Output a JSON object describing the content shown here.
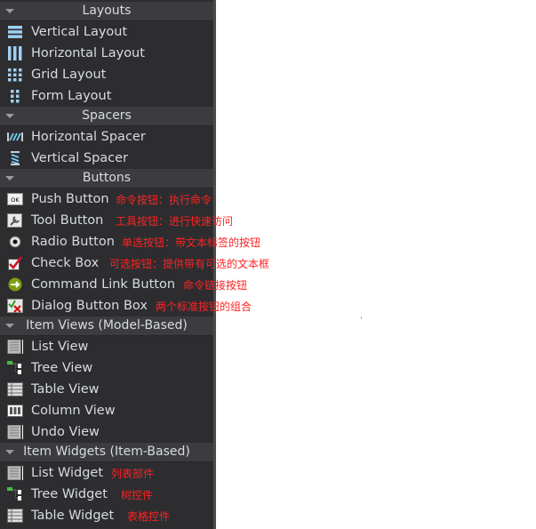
{
  "sections": [
    {
      "title": "Layouts",
      "items": [
        {
          "label": "Vertical Layout",
          "icon": "vertical-layout-icon"
        },
        {
          "label": "Horizontal Layout",
          "icon": "horizontal-layout-icon"
        },
        {
          "label": "Grid Layout",
          "icon": "grid-layout-icon"
        },
        {
          "label": "Form Layout",
          "icon": "form-layout-icon"
        }
      ]
    },
    {
      "title": "Spacers",
      "items": [
        {
          "label": "Horizontal Spacer",
          "icon": "horizontal-spacer-icon"
        },
        {
          "label": "Vertical Spacer",
          "icon": "vertical-spacer-icon"
        }
      ]
    },
    {
      "title": "Buttons",
      "items": [
        {
          "label": "Push Button",
          "icon": "push-button-icon",
          "note": "命令按钮：执行命令"
        },
        {
          "label": "Tool Button",
          "icon": "tool-button-icon",
          "note": "工具按钮：进行快速访问"
        },
        {
          "label": "Radio Button",
          "icon": "radio-button-icon",
          "note": "单选按钮：带文本标签的按钮"
        },
        {
          "label": "Check Box",
          "icon": "check-box-icon",
          "note": "可选按钮：提供带有可选的文本框"
        },
        {
          "label": "Command Link Button",
          "icon": "command-link-icon",
          "note": "命令链接按钮"
        },
        {
          "label": "Dialog Button Box",
          "icon": "dialog-button-box-icon",
          "note": "两个标准按钮的组合"
        }
      ]
    },
    {
      "title": "Item Views (Model-Based)",
      "items": [
        {
          "label": "List View",
          "icon": "list-view-icon"
        },
        {
          "label": "Tree View",
          "icon": "tree-view-icon"
        },
        {
          "label": "Table View",
          "icon": "table-view-icon"
        },
        {
          "label": "Column View",
          "icon": "column-view-icon"
        },
        {
          "label": "Undo View",
          "icon": "undo-view-icon"
        }
      ]
    },
    {
      "title": "Item Widgets (Item-Based)",
      "items": [
        {
          "label": "List Widget",
          "icon": "list-widget-icon",
          "note": "列表部件"
        },
        {
          "label": "Tree Widget",
          "icon": "tree-widget-icon",
          "note": "树控件"
        },
        {
          "label": "Table Widget",
          "icon": "table-widget-icon",
          "note": "表格控件"
        }
      ]
    }
  ],
  "colors": {
    "panel": "#2d2d30",
    "header": "#3c3c3f",
    "text": "#d6dbe2",
    "annotation": "#ff2222"
  }
}
